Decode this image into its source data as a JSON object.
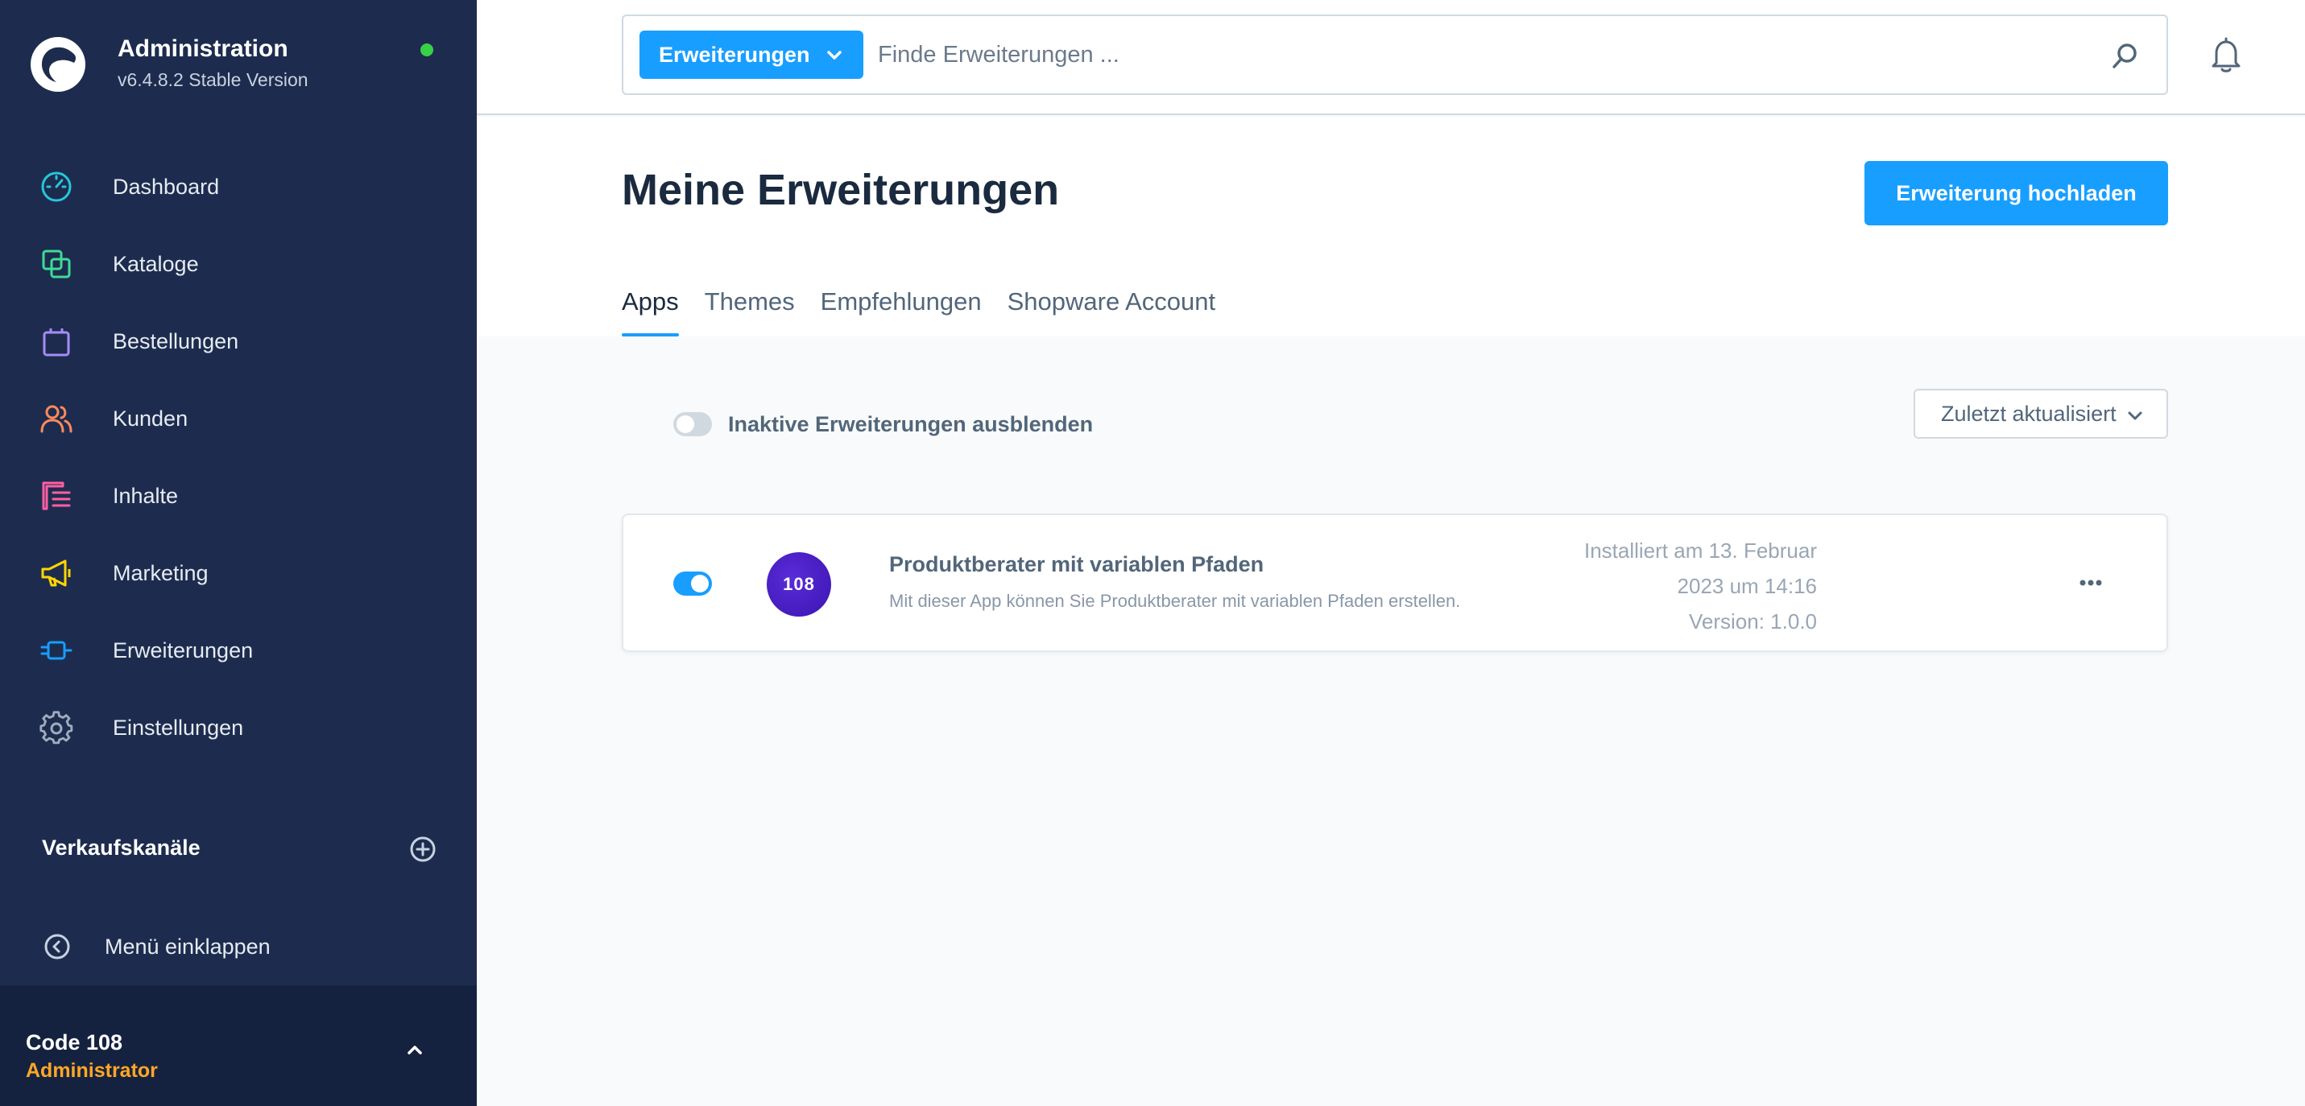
{
  "app": {
    "title": "Administration",
    "version": "v6.4.8.2 Stable Version",
    "status_color": "#37d046"
  },
  "sidebar": {
    "items": [
      {
        "label": "Dashboard",
        "icon": "dashboard-gauge-icon",
        "color": "#26c6da"
      },
      {
        "label": "Kataloge",
        "icon": "catalog-icon",
        "color": "#3ddc97"
      },
      {
        "label": "Bestellungen",
        "icon": "shopping-bag-icon",
        "color": "#a78bfa"
      },
      {
        "label": "Kunden",
        "icon": "customers-icon",
        "color": "#ff8a5c"
      },
      {
        "label": "Inhalte",
        "icon": "content-icon",
        "color": "#ff5fa2"
      },
      {
        "label": "Marketing",
        "icon": "megaphone-icon",
        "color": "#ffd600"
      },
      {
        "label": "Erweiterungen",
        "icon": "plug-icon",
        "color": "#189eff"
      },
      {
        "label": "Einstellungen",
        "icon": "gear-icon",
        "color": "#a0acbd"
      }
    ],
    "sales_channels_label": "Verkaufskanäle",
    "collapse_label": "Menü einklappen"
  },
  "user": {
    "name": "Code 108",
    "role": "Administrator"
  },
  "search": {
    "type_label": "Erweiterungen",
    "placeholder": "Finde Erweiterungen ..."
  },
  "page": {
    "title": "Meine Erweiterungen",
    "upload_label": "Erweiterung hochladen",
    "tabs": [
      {
        "label": "Apps",
        "active": true
      },
      {
        "label": "Themes",
        "active": false
      },
      {
        "label": "Empfehlungen",
        "active": false
      },
      {
        "label": "Shopware Account",
        "active": false
      }
    ]
  },
  "filter": {
    "hide_inactive_label": "Inaktive Erweiterungen ausblenden",
    "hide_inactive_on": false,
    "sort_label": "Zuletzt aktualisiert"
  },
  "extensions": [
    {
      "logo_text": "108",
      "name": "Produktberater mit variablen Pfaden",
      "description": "Mit dieser App können Sie Produktberater mit variablen Pfaden erstellen.",
      "installed_line1": "Installiert am 13. Februar",
      "installed_line2": "2023 um 14:16",
      "version": "Version: 1.0.0",
      "active": true
    }
  ],
  "accent_color": "#189eff"
}
